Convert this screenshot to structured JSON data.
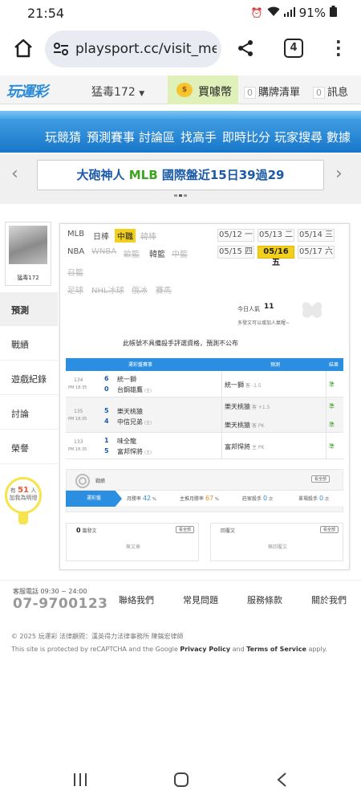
{
  "status_bar": {
    "time": "21:54",
    "battery": "91%"
  },
  "browser": {
    "url": "playsport.cc/visit_mem",
    "tab_count": "4"
  },
  "site_header": {
    "logo": "玩運彩",
    "username": "猛毒172",
    "coin_label": "買噱幣",
    "cart_count": "0",
    "cart_label": "購牌清單",
    "msg_count": "0",
    "msg_label": "訊息"
  },
  "nav": [
    "玩競猜",
    "預測賽事",
    "討論區",
    "找高手",
    "即時比分",
    "玩家搜尋",
    "數據"
  ],
  "banner": {
    "prefix": "大砲神人 ",
    "highlight": "MLB",
    "suffix": " 國際盤近15日39過29"
  },
  "profile": {
    "name": "猛毒172",
    "menu": [
      "預測",
      "戰績",
      "遊戲紀錄",
      "討論",
      "榮譽"
    ],
    "likes_prefix": "有",
    "likes_count": "51",
    "likes_unit": "人",
    "likes_suffix": "加我為明燈"
  },
  "leagues": {
    "row1": [
      "MLB",
      "日棒",
      "中職",
      "韓棒"
    ],
    "row2": [
      "NBA",
      "WNBA",
      "歐籃",
      "韓籃",
      "中籃"
    ],
    "row3": [
      "日籃"
    ],
    "row4": [
      "足球",
      "NHL冰球",
      "俄冰",
      "賽馬"
    ],
    "selected": "中職"
  },
  "dates": [
    {
      "date": "05/12",
      "day": "一"
    },
    {
      "date": "05/13",
      "day": "二"
    },
    {
      "date": "05/14",
      "day": "三"
    },
    {
      "date": "05/15",
      "day": "四"
    },
    {
      "date": "05/16",
      "day": "五"
    },
    {
      "date": "05/17",
      "day": "六"
    }
  ],
  "selected_date": "05/16",
  "popularity": {
    "label": "今日人氣",
    "value": "11",
    "note": "多發文可以增加人氣喔~"
  },
  "notice": "此帳號不具備殺手評選資格，預測不公布",
  "table": {
    "headers": [
      "運彩盤賽事",
      "預測",
      "結果"
    ],
    "rows": [
      {
        "id": "134",
        "time": "PM 18:35",
        "away_score": "6",
        "away": "統一獅",
        "home_score": "0",
        "home": "台鋼雄鷹",
        "home_tag": "(主)",
        "picks": [
          {
            "team": "統一獅",
            "detail": "客 -1.5",
            "result": "準"
          }
        ]
      },
      {
        "id": "135",
        "time": "PM 18:35",
        "away_score": "5",
        "away": "樂天桃猿",
        "home_score": "4",
        "home": "中信兄弟",
        "home_tag": "(主)",
        "picks": [
          {
            "team": "樂天桃猿",
            "detail": "客 +1.5",
            "result": "準"
          },
          {
            "team": "樂天桃猿",
            "detail": "客 PK",
            "result": "準"
          }
        ]
      },
      {
        "id": "133",
        "time": "PM 18:35",
        "away_score": "1",
        "away": "味全龍",
        "home_score": "5",
        "home": "富邦悍將",
        "home_tag": "(主)",
        "picks": [
          {
            "team": "富邦悍將",
            "detail": "主 PK",
            "result": "準"
          }
        ]
      }
    ]
  },
  "stats": {
    "section_label": "戰績",
    "view_all": "看全部",
    "tab": "運彩盤",
    "items": [
      {
        "label": "月勝率",
        "value": "42",
        "unit": "%"
      },
      {
        "label": "主推月勝率",
        "value": "67",
        "unit": "%"
      },
      {
        "label": "莊家殺手",
        "value": "0",
        "unit": "次"
      },
      {
        "label": "單場殺手",
        "value": "0",
        "unit": "次"
      }
    ]
  },
  "articles": {
    "left": {
      "count": "0",
      "label": "篇發文",
      "view_all": "看全部",
      "empty": "無文章"
    },
    "right": {
      "label": "回覆文",
      "view_all": "看全部",
      "empty": "無回覆文"
    }
  },
  "footer": {
    "hours_label": "客服電話 09:30 ~ 24:00",
    "phone": "07-9700123",
    "links": [
      "聯絡我們",
      "常見問題",
      "服務條款",
      "關於我們"
    ],
    "copyright": "© 2025 玩運彩  法律顧問：漢英得力法律事務所 陳鎬宏律師",
    "recaptcha_pre": "This site is protected by reCAPTCHA and the Google ",
    "privacy": "Privacy Policy",
    "and": " and ",
    "terms": "Terms of Service",
    "apply": " apply."
  },
  "colors": {
    "nav_blue": "#1876c9",
    "selected_yellow": "#f3d01b",
    "result_green": "#38a020",
    "link_blue": "#1a5aa8"
  }
}
